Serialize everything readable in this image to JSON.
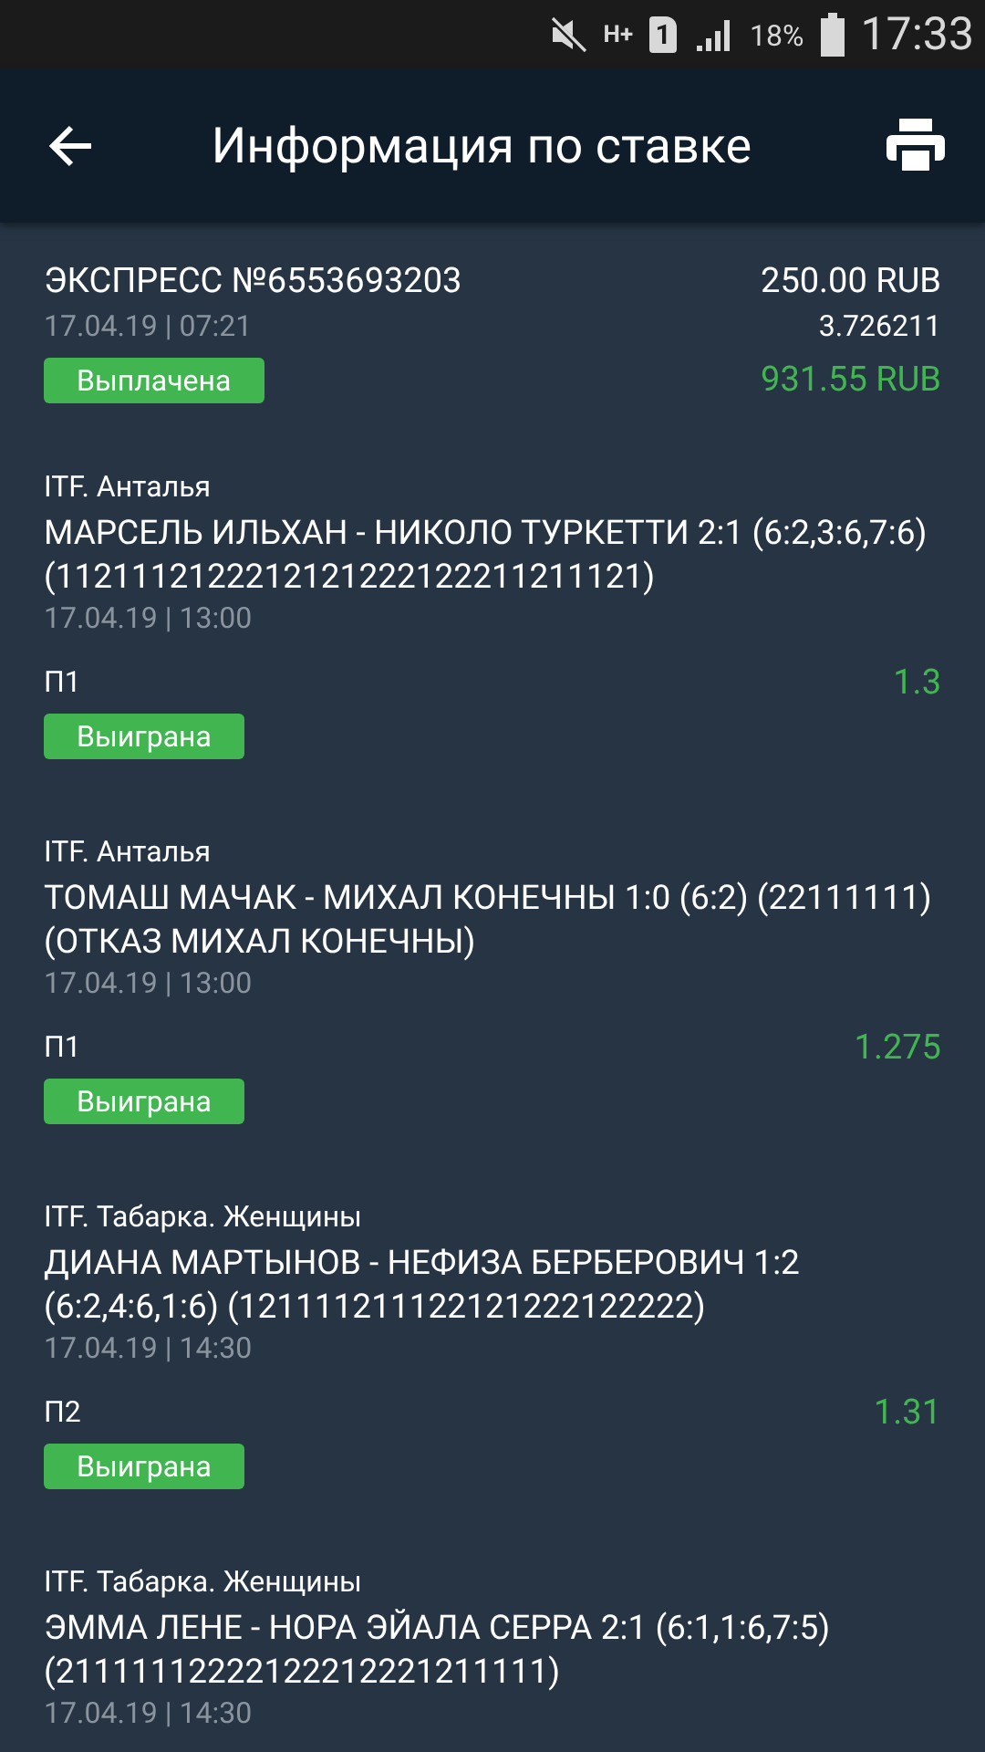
{
  "status_bar": {
    "network": "H+",
    "sim": "1",
    "battery_text": "18%",
    "time": "17:33"
  },
  "header": {
    "title": "Информация по ставке"
  },
  "summary": {
    "title": "ЭКСПРЕСС №6553693203",
    "date": "17.04.19 | 07:21",
    "stake": "250.00 RUB",
    "odds": "3.726211",
    "status": "Выплачена",
    "payout": "931.55 RUB"
  },
  "events": [
    {
      "league": "ITF. Анталья",
      "title": "МАРСЕЛЬ ИЛЬХАН - НИКОЛО ТУРКЕТТИ 2:1 (6:2,3:6,7:6) (1121112122212121222122211211121)",
      "date": "17.04.19 | 13:00",
      "pick": "П1",
      "odds": "1.3",
      "status": "Выиграна"
    },
    {
      "league": "ITF. Анталья",
      "title": "ТОМАШ МАЧАК - МИХАЛ КОНЕЧНЫ 1:0 (6:2) (22111111) (ОТКАЗ МИХАЛ КОНЕЧНЫ)",
      "date": "17.04.19 | 13:00",
      "pick": "П1",
      "odds": "1.275",
      "status": "Выиграна"
    },
    {
      "league": "ITF. Табарка. Женщины",
      "title": "ДИАНА МАРТЫНОВ - НЕФИЗА БЕРБЕРОВИЧ 1:2 (6:2,4:6,1:6) (121111211122121222122222)",
      "date": "17.04.19 | 14:30",
      "pick": "П2",
      "odds": "1.31",
      "status": "Выиграна"
    },
    {
      "league": "ITF. Табарка. Женщины",
      "title": "ЭММА ЛЕНЕ - НОРА ЭЙАЛА СЕРРА 2:1 (6:1,1:6,7:5) (21111112222122212221211111)",
      "date": "17.04.19 | 14:30"
    }
  ]
}
